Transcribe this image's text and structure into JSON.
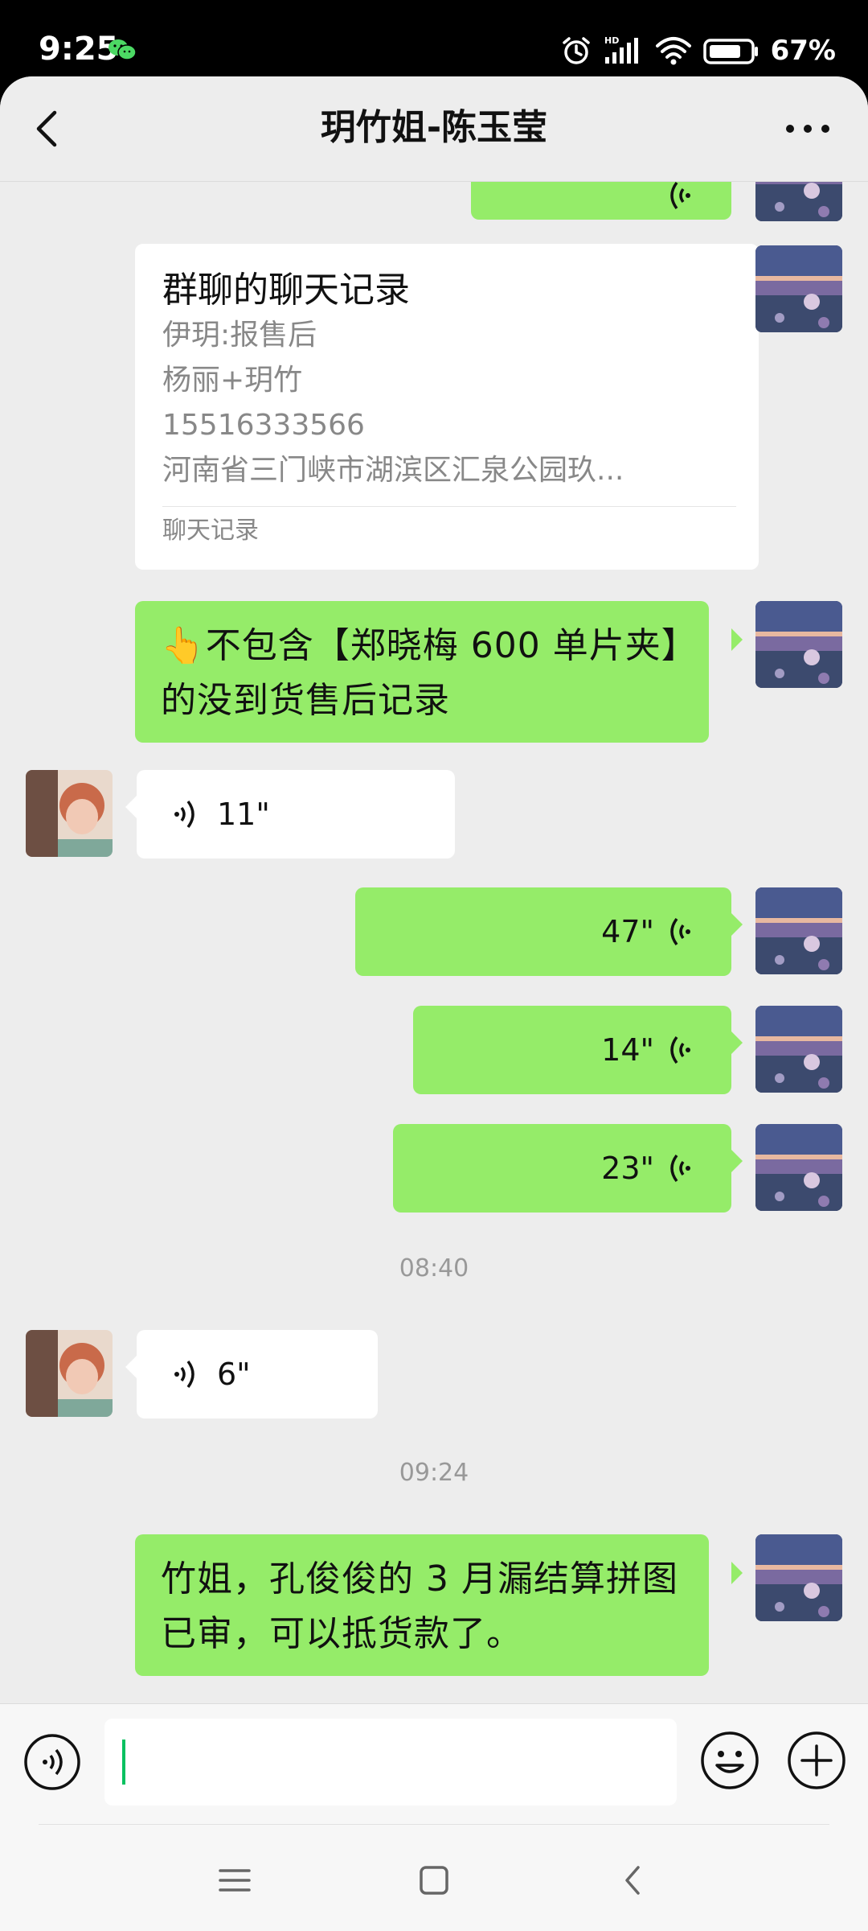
{
  "status_bar": {
    "time": "9:25",
    "battery_percent": "67%",
    "network_badge": "HD",
    "icons": [
      "wechat-icon",
      "alarm-icon",
      "signal-icon",
      "wifi-icon",
      "battery-icon"
    ]
  },
  "header": {
    "title": "玥竹姐-陈玉莹",
    "back_icon": "chevron-left-icon",
    "more_icon": "more-dots-icon"
  },
  "chat_record_card": {
    "title": "群聊的聊天记录",
    "lines": [
      "伊玥:报售后",
      "杨丽+玥竹",
      "15516333566",
      "河南省三门峡市湖滨区汇泉公园玖..."
    ],
    "footer": "聊天记录"
  },
  "messages": {
    "note_text": "👆不包含【郑晓梅 600 单片夹】的没到货售后记录",
    "voice_in_1": "11\"",
    "voice_out_1": "47\"",
    "voice_out_2": "14\"",
    "voice_out_3": "23\"",
    "time_1": "08:40",
    "voice_in_2": "6\"",
    "time_2": "09:24",
    "final_text": "竹姐，孔俊俊的 3 月漏结算拼图已审，可以抵货款了。"
  },
  "input_bar": {
    "value": "",
    "voice_icon": "voice-input-icon",
    "emoji_icon": "emoji-icon",
    "plus_icon": "plus-icon"
  },
  "nav_bar": {
    "icons": [
      "menu-icon",
      "home-icon",
      "back-icon"
    ]
  },
  "colors": {
    "outgoing_bubble": "#95ec69",
    "incoming_bubble": "#ffffff",
    "background": "#ededed"
  }
}
